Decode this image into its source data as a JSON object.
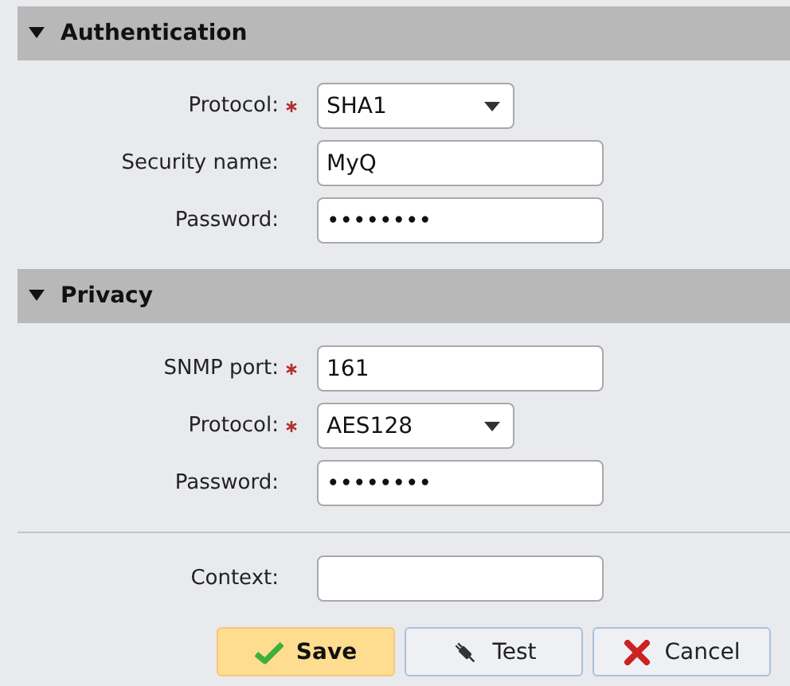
{
  "sections": [
    {
      "title": "Authentication",
      "expanded": true,
      "fields": [
        {
          "label": "Protocol:",
          "required": true,
          "kind": "select",
          "value": "SHA1"
        },
        {
          "label": "Security name:",
          "required": false,
          "kind": "text",
          "value": "MyQ"
        },
        {
          "label": "Password:",
          "required": false,
          "kind": "text",
          "value": "••••••••"
        }
      ]
    },
    {
      "title": "Privacy",
      "expanded": true,
      "fields": [
        {
          "label": "SNMP port:",
          "required": true,
          "kind": "text",
          "value": "161"
        },
        {
          "label": "Protocol:",
          "required": true,
          "kind": "select",
          "value": "AES128"
        },
        {
          "label": "Password:",
          "required": false,
          "kind": "text",
          "value": "••••••••"
        }
      ]
    }
  ],
  "extra_fields": [
    {
      "label": "Context:",
      "required": false,
      "kind": "text"
    }
  ],
  "buttons": [
    {
      "label": "Save",
      "kind": "save"
    },
    {
      "label": "Test",
      "kind": "test"
    },
    {
      "label": "Cancel",
      "kind": "cancel"
    }
  ]
}
